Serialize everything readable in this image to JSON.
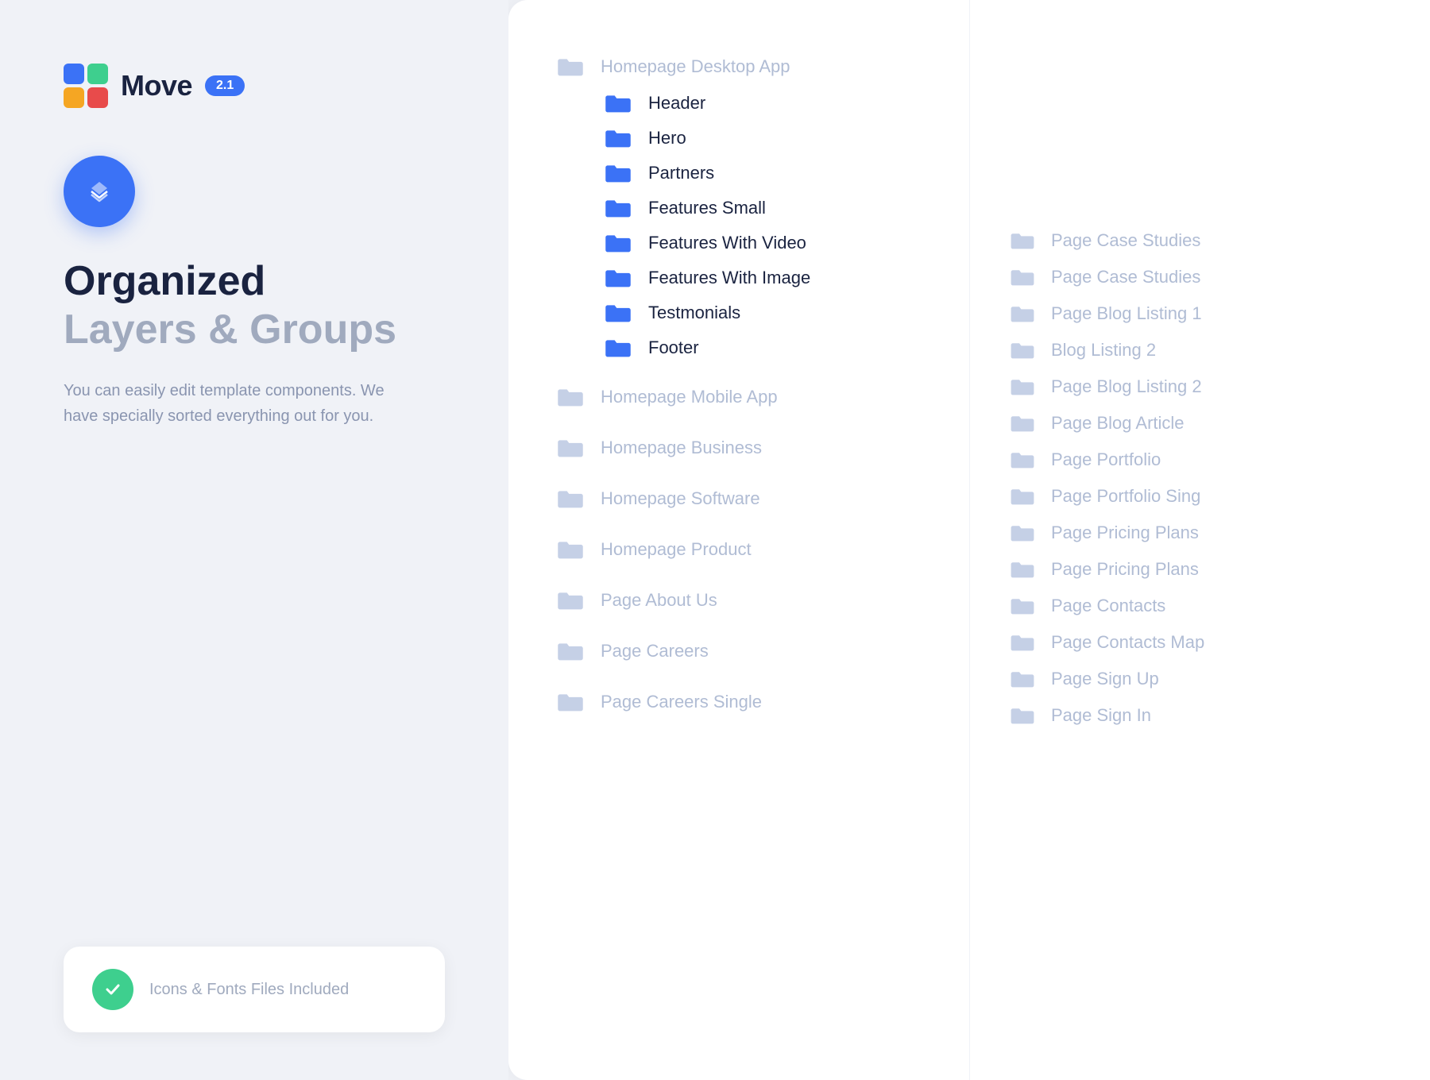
{
  "logo": {
    "text": "Move",
    "version": "2.1"
  },
  "hero": {
    "heading1": "Organized",
    "heading2": "Layers & Groups",
    "description": "You can easily edit template components. We have specially sorted everything out for you."
  },
  "bottom_card": {
    "label": "Icons & Fonts Files Included"
  },
  "middle_items": [
    {
      "id": "homepage-desktop-app",
      "label": "Homepage Desktop App",
      "level": "top",
      "folder_type": "dimmed"
    },
    {
      "id": "header",
      "label": "Header",
      "level": "sub",
      "folder_type": "active"
    },
    {
      "id": "hero",
      "label": "Hero",
      "level": "sub",
      "folder_type": "active"
    },
    {
      "id": "partners",
      "label": "Partners",
      "level": "sub",
      "folder_type": "active"
    },
    {
      "id": "features-small",
      "label": "Features Small",
      "level": "sub",
      "folder_type": "active"
    },
    {
      "id": "features-with-video",
      "label": "Features With Video",
      "level": "sub",
      "folder_type": "active"
    },
    {
      "id": "features-with-image",
      "label": "Features With Image",
      "level": "sub",
      "folder_type": "active"
    },
    {
      "id": "testmonials",
      "label": "Testmonials",
      "level": "sub",
      "folder_type": "active"
    },
    {
      "id": "footer",
      "label": "Footer",
      "level": "sub",
      "folder_type": "active"
    },
    {
      "id": "homepage-mobile-app",
      "label": "Homepage Mobile App",
      "level": "top",
      "folder_type": "dimmed"
    },
    {
      "id": "homepage-business",
      "label": "Homepage Business",
      "level": "top",
      "folder_type": "dimmed"
    },
    {
      "id": "homepage-software",
      "label": "Homepage Software",
      "level": "top",
      "folder_type": "dimmed"
    },
    {
      "id": "homepage-product",
      "label": "Homepage Product",
      "level": "top",
      "folder_type": "dimmed"
    },
    {
      "id": "page-about-us",
      "label": "Page About Us",
      "level": "top",
      "folder_type": "dimmed"
    },
    {
      "id": "page-careers",
      "label": "Page Careers",
      "level": "top",
      "folder_type": "dimmed"
    },
    {
      "id": "page-careers-single",
      "label": "Page Careers Single",
      "level": "top",
      "folder_type": "dimmed"
    }
  ],
  "right_items": [
    {
      "id": "page-case-studies-1",
      "label": "Page Case Studies"
    },
    {
      "id": "page-case-studies-2",
      "label": "Page Case Studies"
    },
    {
      "id": "page-blog-listing-1",
      "label": "Page Blog Listing 1"
    },
    {
      "id": "blog-listing-2",
      "label": "Blog Listing 2"
    },
    {
      "id": "page-blog-listing-2",
      "label": "Page Blog Listing 2"
    },
    {
      "id": "page-blog-article",
      "label": "Page Blog Article"
    },
    {
      "id": "page-portfolio",
      "label": "Page Portfolio"
    },
    {
      "id": "page-portfolio-sing",
      "label": "Page Portfolio Sing"
    },
    {
      "id": "page-pricing-plans-1",
      "label": "Page Pricing Plans"
    },
    {
      "id": "page-pricing-plans-2",
      "label": "Page Pricing Plans"
    },
    {
      "id": "page-contacts",
      "label": "Page Contacts"
    },
    {
      "id": "page-contacts-map",
      "label": "Page Contacts Map"
    },
    {
      "id": "page-sign-up",
      "label": "Page Sign Up"
    },
    {
      "id": "page-sign-in",
      "label": "Page Sign In"
    }
  ],
  "colors": {
    "blue": "#3b72f6",
    "green": "#3ecf8e",
    "orange": "#f5a623",
    "red": "#e84b4b",
    "dark": "#1a2340",
    "mid": "#a0aabe",
    "light": "#b0bcd4",
    "dimmed_folder": "#c5d0e6",
    "active_folder": "#3b72f6"
  }
}
